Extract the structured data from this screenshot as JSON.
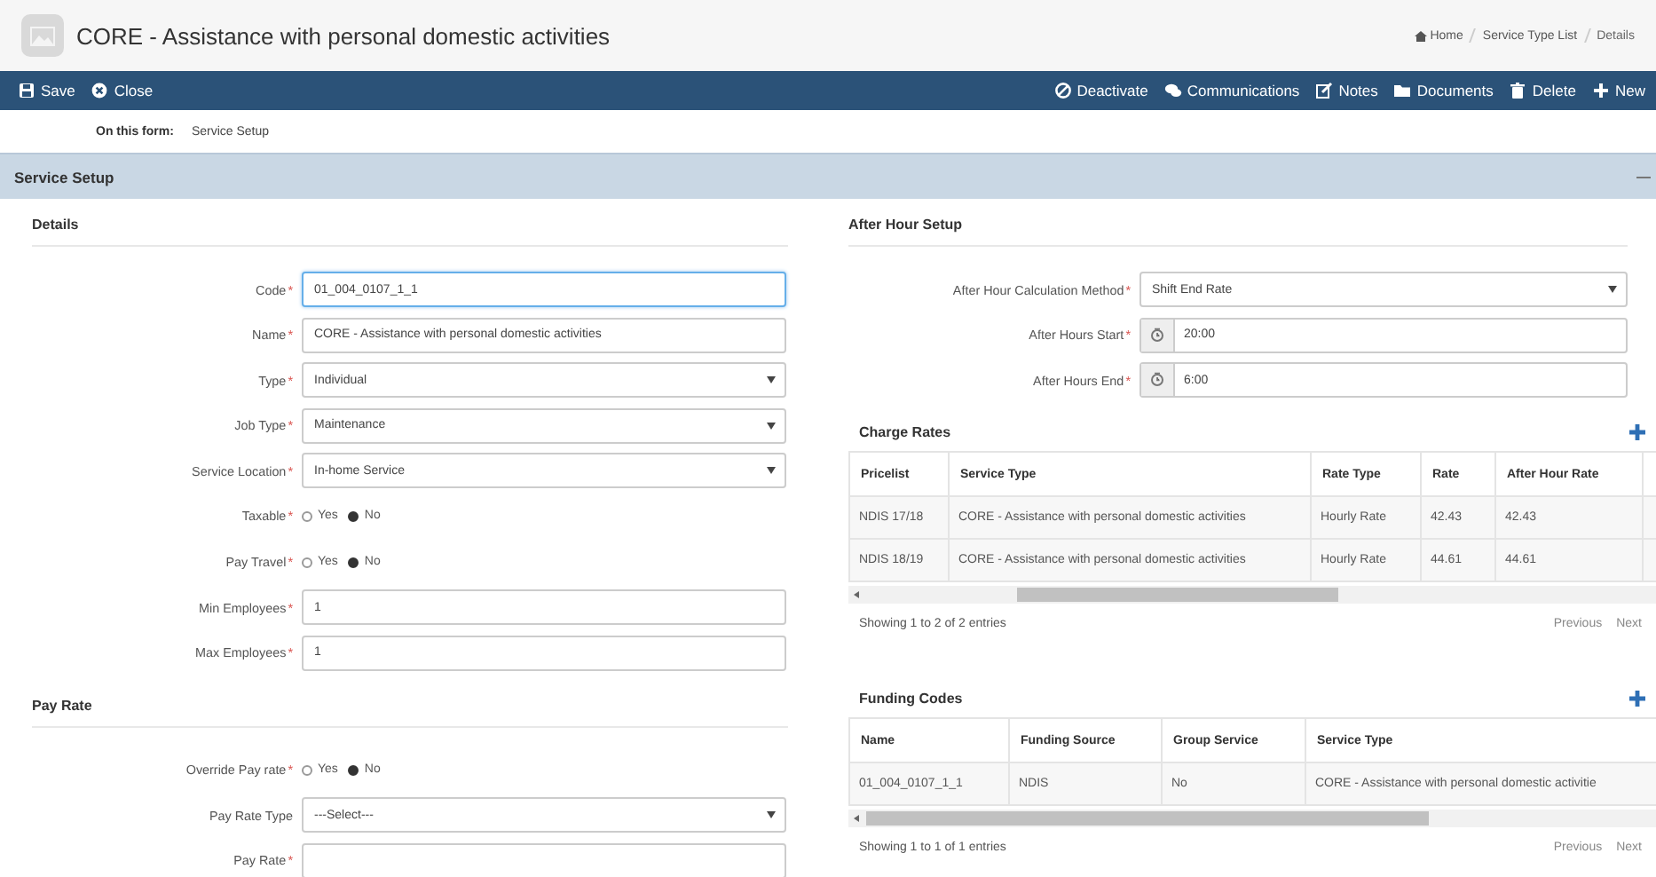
{
  "header": {
    "title": "CORE - Assistance with personal domestic activities",
    "breadcrumb": [
      {
        "label": "Home",
        "kind": "home"
      },
      {
        "label": "Service Type List",
        "kind": "link"
      },
      {
        "label": "Details",
        "kind": "current"
      }
    ]
  },
  "toolbar": {
    "left": [
      {
        "label": "Save",
        "kind": "save"
      },
      {
        "label": "Close",
        "kind": "close"
      }
    ],
    "right": [
      {
        "label": "Deactivate",
        "kind": "deactivate"
      },
      {
        "label": "Communications",
        "kind": "communications"
      },
      {
        "label": "Notes",
        "kind": "notes"
      },
      {
        "label": "Documents",
        "kind": "documents"
      },
      {
        "label": "Delete",
        "kind": "delete"
      },
      {
        "label": "New",
        "kind": "new"
      }
    ]
  },
  "form_nav": {
    "label": "On this form:",
    "links": [
      "Service Setup"
    ]
  },
  "section": {
    "title": "Service Setup",
    "expanded": true
  },
  "left": [
    {
      "title": "Details",
      "fields": [
        {
          "kind": "text",
          "label": "Code",
          "required": "*",
          "value": "01_004_0107_1_1",
          "focused": true
        },
        {
          "kind": "text",
          "label": "Name",
          "required": "*",
          "value": "CORE - Assistance with personal domestic activities",
          "focused": false
        },
        {
          "kind": "select",
          "label": "Type",
          "required": "*",
          "value": "Individual",
          "focused": false
        },
        {
          "kind": "select",
          "label": "Job Type",
          "required": "*",
          "value": "Maintenance",
          "focused": false
        },
        {
          "kind": "select",
          "label": "Service Location",
          "required": "*",
          "value": "In-home Service",
          "focused": false
        },
        {
          "kind": "radio",
          "label": "Taxable",
          "required": "*",
          "options": [
            {
              "label": "Yes",
              "selected": false
            },
            {
              "label": "No",
              "selected": true
            }
          ]
        },
        {
          "kind": "radio",
          "label": "Pay Travel",
          "required": "*",
          "options": [
            {
              "label": "Yes",
              "selected": false
            },
            {
              "label": "No",
              "selected": true
            }
          ]
        },
        {
          "kind": "text",
          "label": "Min Employees",
          "required": "*",
          "value": "1",
          "focused": false
        },
        {
          "kind": "text",
          "label": "Max Employees",
          "required": "*",
          "value": "1",
          "focused": false
        }
      ]
    },
    {
      "title": "Pay Rate",
      "fields": [
        {
          "kind": "radio",
          "label": "Override Pay rate",
          "required": "*",
          "options": [
            {
              "label": "Yes",
              "selected": false
            },
            {
              "label": "No",
              "selected": true
            }
          ]
        },
        {
          "kind": "select",
          "label": "Pay Rate Type",
          "value": "---Select---",
          "focused": false
        },
        {
          "kind": "text",
          "label": "Pay Rate",
          "required": "*",
          "focused": false
        }
      ]
    }
  ],
  "right": {
    "after_hour": {
      "title": "After Hour Setup",
      "fields": [
        {
          "kind": "select",
          "label": "After Hour Calculation Method",
          "required": "*",
          "value": "Shift End Rate",
          "focused": false
        },
        {
          "kind": "time",
          "label": "After Hours Start",
          "required": "*",
          "value": "20:00",
          "focused": false
        },
        {
          "kind": "time",
          "label": "After Hours End",
          "required": "*",
          "value": "6:00",
          "focused": false
        }
      ]
    },
    "tables": [
      {
        "title": "Charge Rates",
        "columns": [
          "Pricelist",
          "Service Type",
          "Rate Type",
          "Rate",
          "After Hour Rate"
        ],
        "rows": [
          [
            "NDIS 17/18",
            "CORE - Assistance with personal domestic activities",
            "Hourly Rate",
            "42.43",
            "42.43"
          ],
          [
            "NDIS 18/19",
            "CORE - Assistance with personal domestic activities",
            "Hourly Rate",
            "44.61",
            "44.61"
          ]
        ],
        "info": "Showing 1 to 2 of 2 entries",
        "pager": [
          "Previous",
          "Next"
        ]
      },
      {
        "title": "Funding Codes",
        "columns": [
          "Name",
          "Funding Source",
          "Group Service",
          "Service Type"
        ],
        "rows": [
          [
            "01_004_0107_1_1",
            "NDIS",
            "No",
            "CORE - Assistance with personal domestic activitie"
          ]
        ],
        "info": "Showing 1 to 1 of 1 entries",
        "pager": [
          "Previous",
          "Next"
        ]
      }
    ]
  }
}
